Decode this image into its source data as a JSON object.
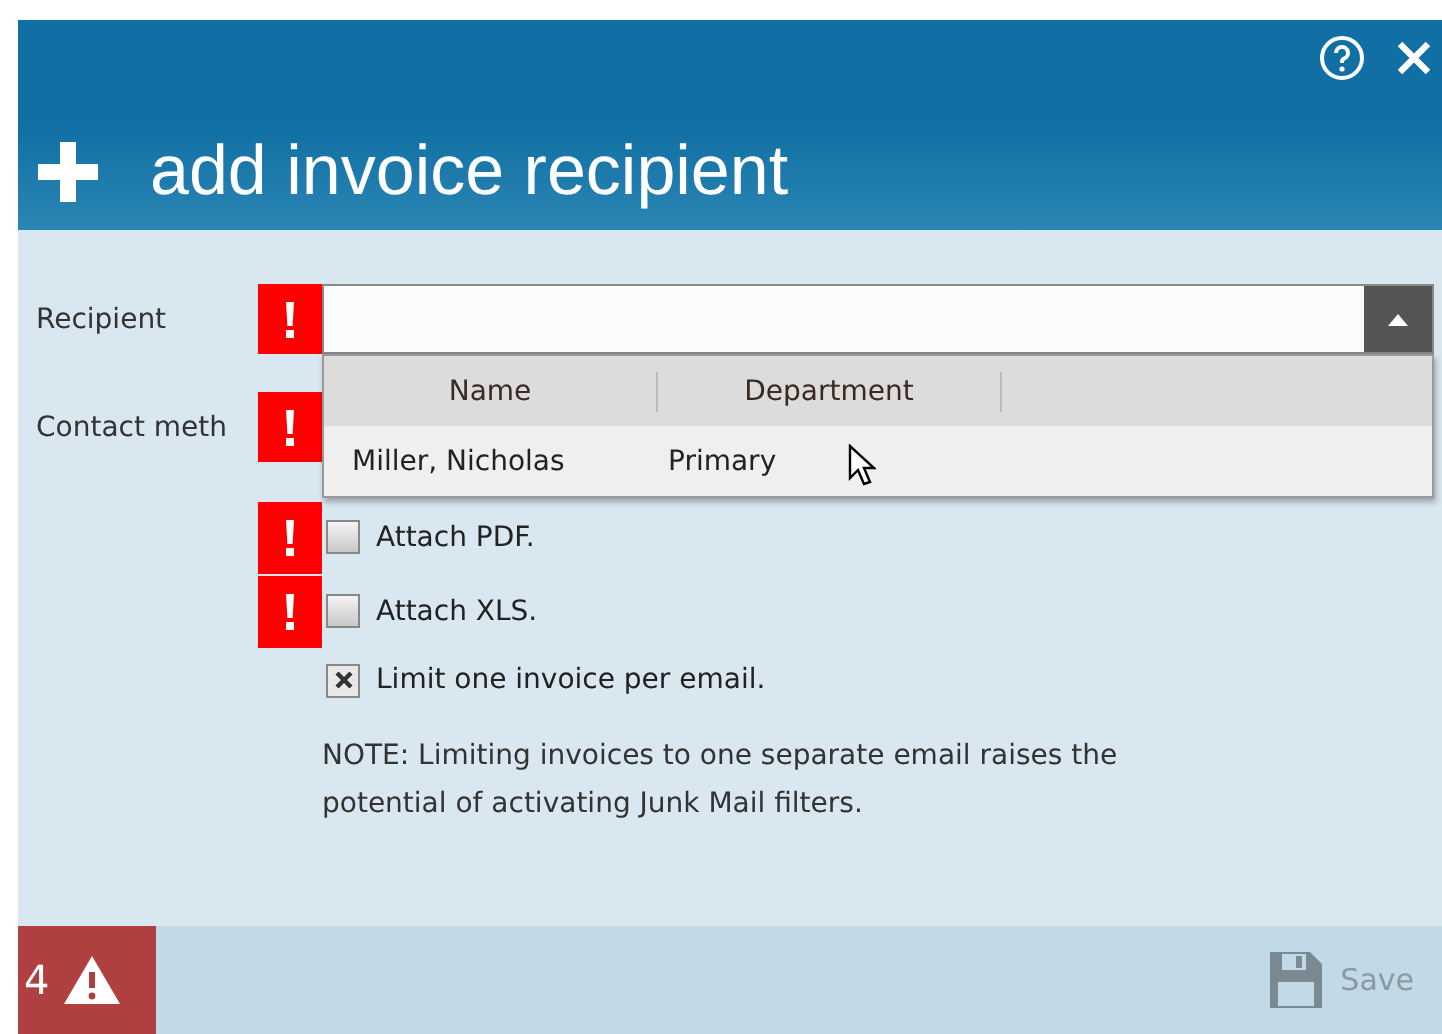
{
  "dialog": {
    "title": "add invoice recipient"
  },
  "recipient": {
    "label": "Recipient",
    "error": true,
    "dropdown": {
      "columns": [
        "Name",
        "Department"
      ],
      "rows": [
        {
          "cells": [
            "Miller, Nicholas",
            "Primary"
          ]
        }
      ]
    }
  },
  "contact_method": {
    "label": "Contact meth",
    "error": true
  },
  "checkboxes": [
    {
      "label": "Attach PDF.",
      "checked": false,
      "error": true
    },
    {
      "label": "Attach XLS.",
      "checked": false,
      "error": true
    },
    {
      "label": "Limit one invoice per email.",
      "checked": true,
      "error": false
    }
  ],
  "note": "NOTE: Limiting invoices to one separate email raises the potential of activating Junk Mail filters.",
  "footer": {
    "error_count": "4",
    "save": {
      "label": "Save",
      "disabled": true
    }
  }
}
